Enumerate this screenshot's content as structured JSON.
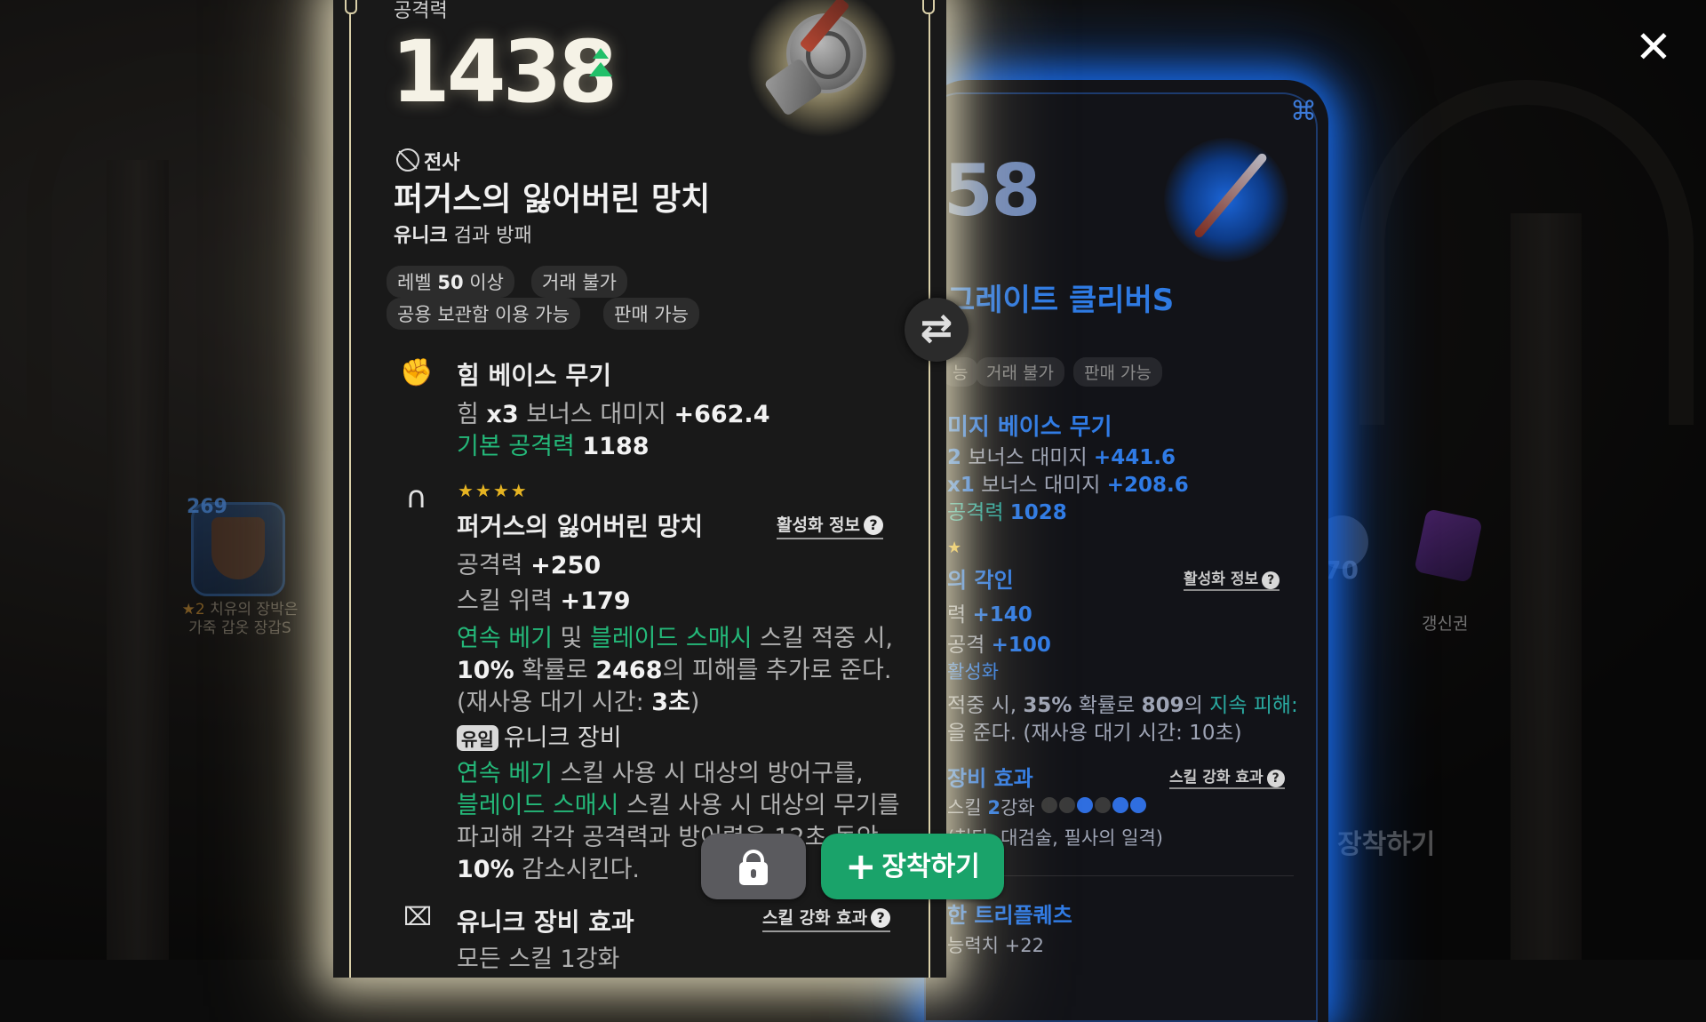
{
  "close_label": "✕",
  "background": {
    "slot_number": "269",
    "slot_label_star": "★2",
    "slot_label_text": "치유의 장박은 가죽 갑옷 장갑S",
    "ticket_label": "갱신권",
    "side_number": "70",
    "equip_text": "장착하기"
  },
  "main_card": {
    "stat_label": "공격력",
    "stat_value": "1438",
    "class_name": "전사",
    "item_name": "퍼거스의 잃어버린 망치",
    "item_rarity": "유니크",
    "item_type": "검과 방패",
    "tags": [
      {
        "prefix": "레벨",
        "strong": "50",
        "suffix": "이상"
      },
      {
        "prefix": "거래 불가",
        "strong": "",
        "suffix": ""
      },
      {
        "prefix": "공용 보관함 이용 가능",
        "strong": "",
        "suffix": ""
      },
      {
        "prefix": "판매 가능",
        "strong": "",
        "suffix": ""
      }
    ],
    "base_section": {
      "title": "힘 베이스 무기",
      "line1_a": "힘",
      "line1_b": "x3",
      "line1_c": "보너스 대미지",
      "line1_d": "+662.4",
      "line2_a": "기본 공격력",
      "line2_b": "1188"
    },
    "enchant_section": {
      "stars": "★★★★",
      "title": "퍼거스의 잃어버린 망치",
      "activation_link": "활성화 정보",
      "atk_label": "공격력",
      "atk_value": "+250",
      "skill_label": "스킬 위력",
      "skill_value": "+179",
      "desc1_skill1": "연속 베기",
      "desc1_and": "및",
      "desc1_skill2": "블레이드 스매시",
      "desc1_rest": "스킬 적중 시,",
      "desc2_pct": "10%",
      "desc2_mid": "확률로",
      "desc2_dmg": "2468",
      "desc2_rest": "의 피해를 추가로 준다.",
      "desc3_a": "(재사용 대기 시간:",
      "desc3_b": "3초",
      "desc3_c": ")",
      "unique_badge": "유일",
      "unique_label": "유니크 장비",
      "u1_skill": "연속 베기",
      "u1_rest": "스킬 사용 시 대상의 방어구를,",
      "u2_skill": "블레이드 스매시",
      "u2_rest": "스킬 사용 시 대상의 무기를",
      "u3": "파괴해 각각 공격력과 방어력을 12초 동안",
      "u4_pct": "10%",
      "u4_rest": "감소시킨다."
    },
    "unique_effect": {
      "title": "유니크 장비 효과",
      "link": "스킬 강화 효과",
      "line_partial": "모든 스킬 1강화"
    }
  },
  "compare_card": {
    "power_partial": "58",
    "name_partial": "그레이트 클리버S",
    "tag1_partial": "능",
    "tag2": "거래 불가",
    "tag3": "판매 가능",
    "base_title_partial": "미지 베이스 무기",
    "l1_a": "2",
    "l1_b": "보너스 대미지",
    "l1_c": "+441.6",
    "l2_a": "x1",
    "l2_b": "보너스 대미지",
    "l2_c": "+208.6",
    "l3_a": "공격력",
    "l3_b": "1028",
    "star": "★",
    "engrave_partial": "의 각인",
    "activation_link": "활성화 정보",
    "e1_a": "력",
    "e1_b": "+140",
    "e2_a": "공격",
    "e2_b": "+100",
    "e3": "활성화",
    "e4_a": "적중 시,",
    "e4_b": "35%",
    "e4_c": "확률로",
    "e4_d": "809",
    "e4_e": "의",
    "e4_f": "지속 피해:",
    "e5": "을 준다. (재사용 대기 시간: 10초)",
    "u_title_partial": "장비 효과",
    "u_link": "스킬 강화 효과",
    "u1_a": "스킬",
    "u1_b": "2",
    "u1_c": "강화",
    "u2": "(첫타, 대검술, 필사의 일격)",
    "t_title_partial": "한 트리플퀘츠",
    "t1": "능력치 +22"
  },
  "buttons": {
    "equip_label": "장착하기",
    "equip_plus": "+"
  }
}
